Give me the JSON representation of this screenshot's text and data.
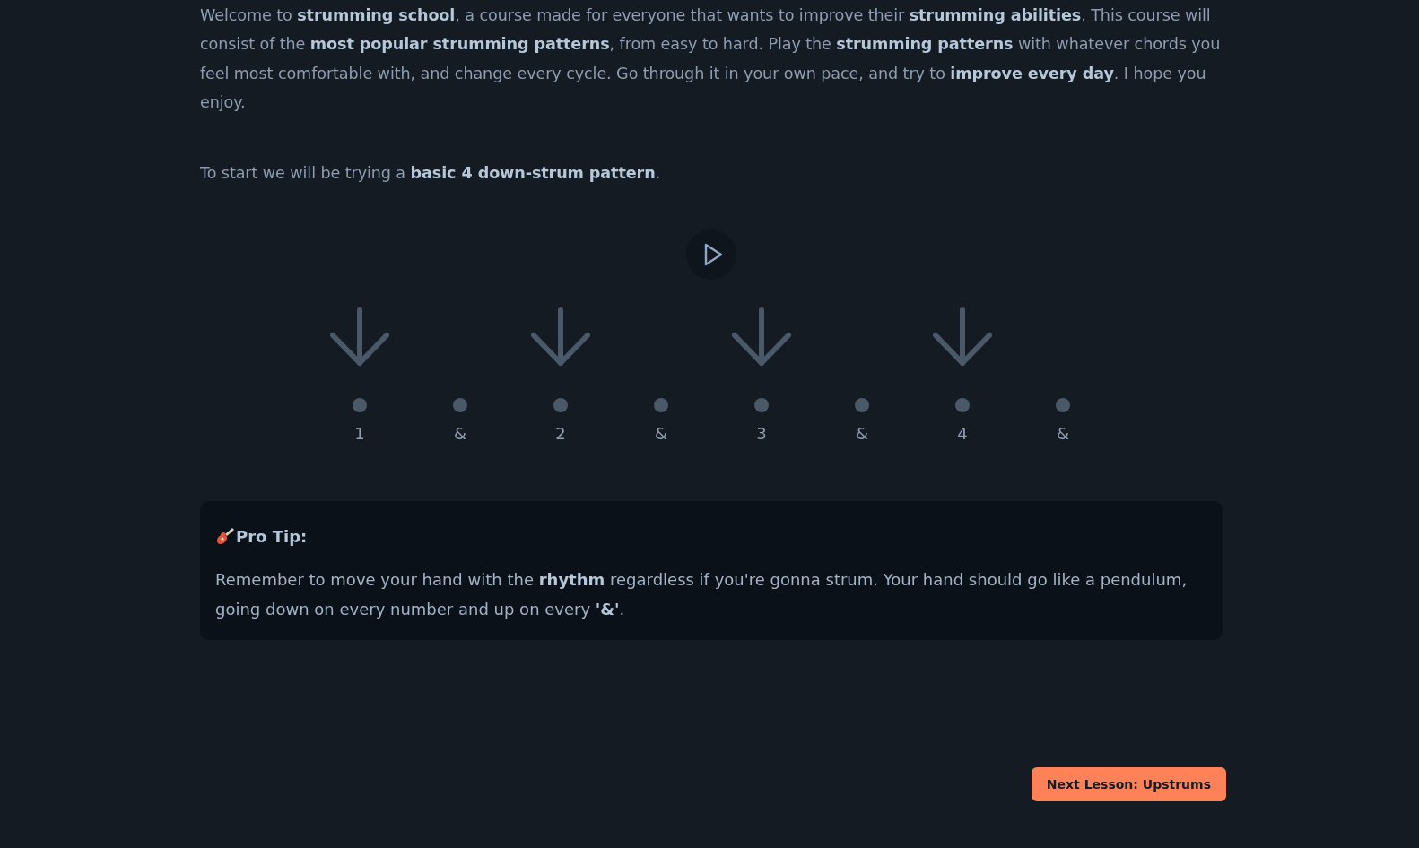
{
  "intro": [
    "Welcome to **strumming school**, a course made for everyone that wants to improve their **strumming abilities**. This course will consist of the **most popular strumming patterns**, from easy to hard. Play the **strumming patterns** with whatever chords you feel most comfortable with, and change every cycle. Go through it in your own pace, and try to **improve every day**. I hope you enjoy.",
    "To start we will be trying a **basic 4 down-strum pattern**."
  ],
  "player": {
    "playing": false
  },
  "beats": [
    {
      "label": "1",
      "kind": "down"
    },
    {
      "label": "&",
      "kind": "none"
    },
    {
      "label": "2",
      "kind": "down"
    },
    {
      "label": "&",
      "kind": "none"
    },
    {
      "label": "3",
      "kind": "down"
    },
    {
      "label": "&",
      "kind": "none"
    },
    {
      "label": "4",
      "kind": "down"
    },
    {
      "label": "&",
      "kind": "none"
    }
  ],
  "tip": {
    "title": "Pro Tip:",
    "text": "Remember to move your hand with the **rhythm** regardless if you're gonna strum. Your hand should go like a pendulum, going down on every number and up on every **'&'**."
  },
  "next_button": "Next Lesson: Upstrums"
}
